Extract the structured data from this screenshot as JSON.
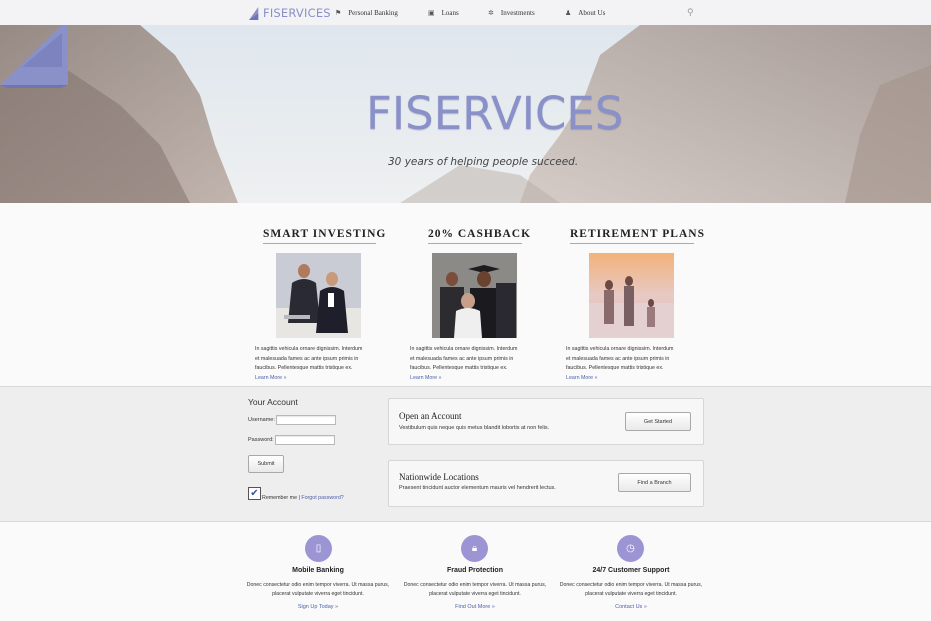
{
  "nav": {
    "logo": "FISERVICES",
    "items": [
      {
        "label": "Personal Banking",
        "icon": "flag-icon"
      },
      {
        "label": "Loans",
        "icon": "wallet-icon"
      },
      {
        "label": "Investments",
        "icon": "gear-icon"
      },
      {
        "label": "About Us",
        "icon": "user-icon"
      }
    ],
    "search_icon": "search-icon"
  },
  "hero": {
    "title": "FISERVICES",
    "tagline": "30 years of helping people succeed."
  },
  "features": [
    {
      "title": "SMART INVESTING",
      "text": "In sagittis vehicula ornare dignissim. Interdum et malesuada fames ac ante ipsum primis in faucibus. Pellentesque mattis tristique ex.",
      "link": "Learn More »"
    },
    {
      "title": "20% CASHBACK",
      "text": "In sagittis vehicula ornare dignissim. Interdum et malesuada fames ac ante ipsum primis in faucibus. Pellentesque mattis tristique ex.",
      "link": "Learn More »"
    },
    {
      "title": "RETIREMENT PLANS",
      "text": "In sagittis vehicula ornare dignissim. Interdum et malesuada fames ac ante ipsum primis in faucibus. Pellentesque mattis tristique ex.",
      "link": "Learn More »"
    }
  ],
  "account": {
    "heading": "Your Account",
    "username_label": "Username:",
    "password_label": "Password:",
    "submit": "Submit",
    "remember": "Remember me |",
    "forgot": "Forgot password?"
  },
  "cards": [
    {
      "title": "Open an Account",
      "text": "Vestibulum quis neque quis metus blandit lobortis at non felis.",
      "button": "Get Started"
    },
    {
      "title": "Nationwide Locations",
      "text": "Praesent tincidunt auctor elementum mauris vel hendrerit lectus.",
      "button": "Find a Branch"
    }
  ],
  "bottom": [
    {
      "title": "Mobile Banking",
      "icon": "mobile-icon",
      "text": "Donec consectetur odio enim tempor viverra. Ut massa purus, placerat vulputate viverra eget tincidunt.",
      "link": "Sign Up Today »"
    },
    {
      "title": "Fraud Protection",
      "icon": "lock-icon",
      "text": "Donec consectetur odio enim tempor viverra. Ut massa purus, placerat vulputate viverra eget tincidunt.",
      "link": "Find Out More »"
    },
    {
      "title": "24/7 Customer Support",
      "icon": "clock-icon",
      "text": "Donec consectetur odio enim tempor viverra. Ut massa purus, placerat vulputate viverra eget tincidunt.",
      "link": "Contact Us »"
    }
  ],
  "colors": {
    "accent": "#9c95d3",
    "logo": "#8a90c8",
    "link": "#4a5fa8"
  }
}
